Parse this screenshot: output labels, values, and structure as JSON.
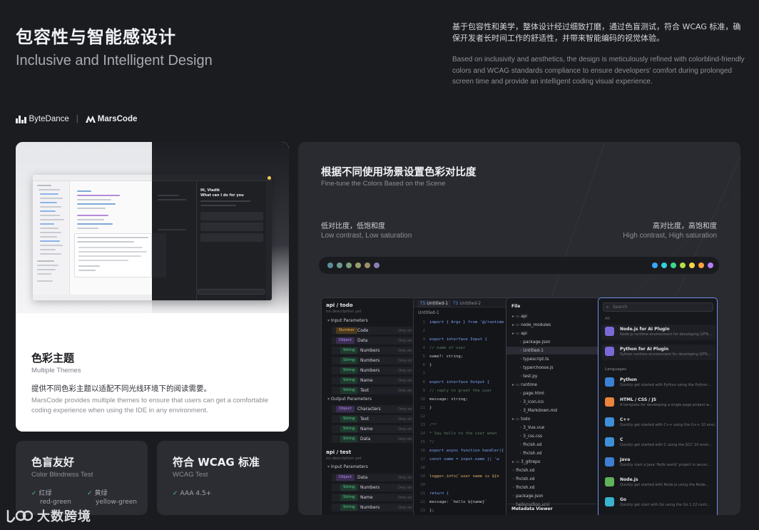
{
  "header": {
    "title_cn": "包容性与智能感设计",
    "title_en": "Inclusive and Intelligent Design",
    "desc_cn": "基于包容性和美学，整体设计经过细致打磨，通过色盲测试，符合 WCAG 标准，确保开发者长时间工作的舒适性，并带来智能编码的视觉体验。",
    "desc_en": "Based on inclusivity and aesthetics, the design is meticulously refined with colorblind-friendly colors and WCAG standards compliance to ensure developers' comfort during prolonged screen time and provide an intelligent coding visual experience."
  },
  "logos": {
    "bytedance": "ByteDance",
    "separator": "|",
    "marscode": "MarsCode"
  },
  "theme_card": {
    "title": "色彩主题",
    "subtitle": "Multiple Themes",
    "desc_cn": "提供不同色彩主题以适配不同光线环境下的阅读需要。",
    "desc_en": "MarsCode provides multiple themes to ensure that users can get a comfortable coding experience when using the IDE in any environment.",
    "ide_chat_title": "Hi, Vladik",
    "ide_chat_sub": "What can I do for you"
  },
  "colorblind_card": {
    "title": "色盲友好",
    "subtitle": "Color Blindness Test",
    "items": [
      {
        "cn": "红绿",
        "en": "red-green"
      },
      {
        "cn": "黄绿",
        "en": "yellow-green"
      }
    ]
  },
  "wcag_card": {
    "title": "符合 WCAG 标准",
    "subtitle": "WCAG Test",
    "item": "AAA 4.5+"
  },
  "contrast_panel": {
    "title": "根据不同使用场景设置色彩对比度",
    "subtitle": "Fine-tune the Colors Based on the Scene",
    "low_cn": "低对比度，低饱和度",
    "low_en": "Low contrast, Low saturation",
    "high_cn": "高对比度，高饱和度",
    "high_en": "High contrast, High saturation",
    "low_dots": [
      "#5b8d99",
      "#6a9c8d",
      "#7d9e7a",
      "#9a9d6d",
      "#9f8f68",
      "#8a7cb5"
    ],
    "high_dots": [
      "#3aa7ff",
      "#2fd1d8",
      "#39d98a",
      "#b4e043",
      "#f5d547",
      "#ff9f43",
      "#b87dff"
    ]
  },
  "api_pane": {
    "path1": "api / todo",
    "path1_sub": "no description yet",
    "input_params": "Input Parameters",
    "output_params": "Output Parameters",
    "path2": "api / test",
    "path2_sub": "no description yet",
    "rows1": [
      {
        "type": "Number",
        "name": "Code"
      },
      {
        "type": "Object",
        "name": "Data"
      },
      {
        "type": "String",
        "name": "Numbers"
      },
      {
        "type": "String",
        "name": "Numbers"
      },
      {
        "type": "String",
        "name": "Numbers"
      },
      {
        "type": "String",
        "name": "Name"
      },
      {
        "type": "String",
        "name": "Text"
      }
    ],
    "rows2": [
      {
        "type": "Object",
        "name": "Characters"
      },
      {
        "type": "String",
        "name": "Text"
      },
      {
        "type": "String",
        "name": "Name"
      },
      {
        "type": "String",
        "name": "Data"
      }
    ],
    "rows3": [
      {
        "type": "Object",
        "name": "Data"
      },
      {
        "type": "String",
        "name": "Numbers"
      },
      {
        "type": "String",
        "name": "Name"
      },
      {
        "type": "String",
        "name": "Numbers"
      }
    ],
    "only_label": "Only str"
  },
  "code_pane": {
    "tab1": "Untitled-1",
    "tab2": "Untitled-2",
    "file": "Untitled-1",
    "lines": [
      {
        "n": "1",
        "c": "import { Args } from '@/runtime"
      },
      {
        "n": "2",
        "c": ""
      },
      {
        "n": "3",
        "c": "export interface Input {"
      },
      {
        "n": "4",
        "c": "  // name of user"
      },
      {
        "n": "5",
        "c": "  name?: string;"
      },
      {
        "n": "6",
        "c": "}"
      },
      {
        "n": "7",
        "c": ""
      },
      {
        "n": "8",
        "c": "export interface Output {"
      },
      {
        "n": "9",
        "c": "  // reply to greet the user"
      },
      {
        "n": "10",
        "c": "  message: string;"
      },
      {
        "n": "11",
        "c": "}"
      },
      {
        "n": "12",
        "c": ""
      },
      {
        "n": "13",
        "c": "/**"
      },
      {
        "n": "14",
        "c": " * Say hello to the user when"
      },
      {
        "n": "15",
        "c": " */"
      },
      {
        "n": "16",
        "c": "export async function handler({"
      },
      {
        "n": "17",
        "c": "  const name = input.name || 'w"
      },
      {
        "n": "18",
        "c": ""
      },
      {
        "n": "19",
        "c": "  logger.info(`user name is ${n"
      },
      {
        "n": "20",
        "c": ""
      },
      {
        "n": "21",
        "c": "  return {"
      },
      {
        "n": "22",
        "c": "    message: `hello ${name}`"
      },
      {
        "n": "23",
        "c": "  };"
      },
      {
        "n": "24",
        "c": "}"
      },
      {
        "n": "25",
        "c": ""
      }
    ]
  },
  "files_pane": {
    "header": "File",
    "footer": "Metadata Viewer",
    "items": [
      {
        "indent": 0,
        "text": "api"
      },
      {
        "indent": 0,
        "text": "node_modules"
      },
      {
        "indent": 0,
        "text": "api"
      },
      {
        "indent": 1,
        "text": "package.json"
      },
      {
        "indent": 1,
        "text": "Untitled-1"
      },
      {
        "indent": 1,
        "text": "typescript.ts"
      },
      {
        "indent": 1,
        "text": "typerchoose.js"
      },
      {
        "indent": 1,
        "text": "test.py"
      },
      {
        "indent": 0,
        "text": "runtime"
      },
      {
        "indent": 1,
        "text": "page.html"
      },
      {
        "indent": 1,
        "text": "3_icon.ico"
      },
      {
        "indent": 1,
        "text": "3_Markdown.md"
      },
      {
        "indent": 0,
        "text": "todo"
      },
      {
        "indent": 1,
        "text": "3_Vue.vue"
      },
      {
        "indent": 1,
        "text": "3_css.css"
      },
      {
        "indent": 1,
        "text": "fhcish.xd"
      },
      {
        "indent": 1,
        "text": "fhcish.xd"
      },
      {
        "indent": 0,
        "text": "3_gitrepo"
      },
      {
        "indent": 0,
        "text": "fhcish.xd"
      },
      {
        "indent": 0,
        "text": "fhcish.xd"
      },
      {
        "indent": 0,
        "text": "fhcish.xd"
      },
      {
        "indent": 0,
        "text": "package.json"
      },
      {
        "indent": 0,
        "text": "hellomotion.xml"
      }
    ]
  },
  "search_pane": {
    "placeholder": "Search",
    "section_all": "All",
    "section_lang": "Languages",
    "featured": [
      {
        "title": "Node.js for AI Plugin",
        "desc": "Node.js runtime environment for developing GPTs...",
        "color": "#7a6ad8"
      },
      {
        "title": "Python for AI Plugin",
        "desc": "Python runtime environment for developing GPTs...",
        "color": "#7a6ad8"
      }
    ],
    "languages": [
      {
        "title": "Python",
        "desc": "Quickly get started with Python using the Python...",
        "color": "#3b82d6"
      },
      {
        "title": "HTML / CSS / JS",
        "desc": "A template for developing a single page project w...",
        "color": "#e9833d"
      },
      {
        "title": "C++",
        "desc": "Quickly get started with C++ using the G++ 10 envi...",
        "color": "#3e8fd8"
      },
      {
        "title": "C",
        "desc": "Quickly get started with C using the GCC 10 envir...",
        "color": "#3e8fd8"
      },
      {
        "title": "Java",
        "desc": "Quickly start a Java 'Hello world' project in secon...",
        "color": "#3e7fd2"
      },
      {
        "title": "Node.js",
        "desc": "Quickly get started with Node.js using the Node...",
        "color": "#5fb35a"
      },
      {
        "title": "Go",
        "desc": "Quickly get start with Go using the Go 1.22 runti...",
        "color": "#39b3cf"
      }
    ]
  },
  "watermark": "大数跨境"
}
